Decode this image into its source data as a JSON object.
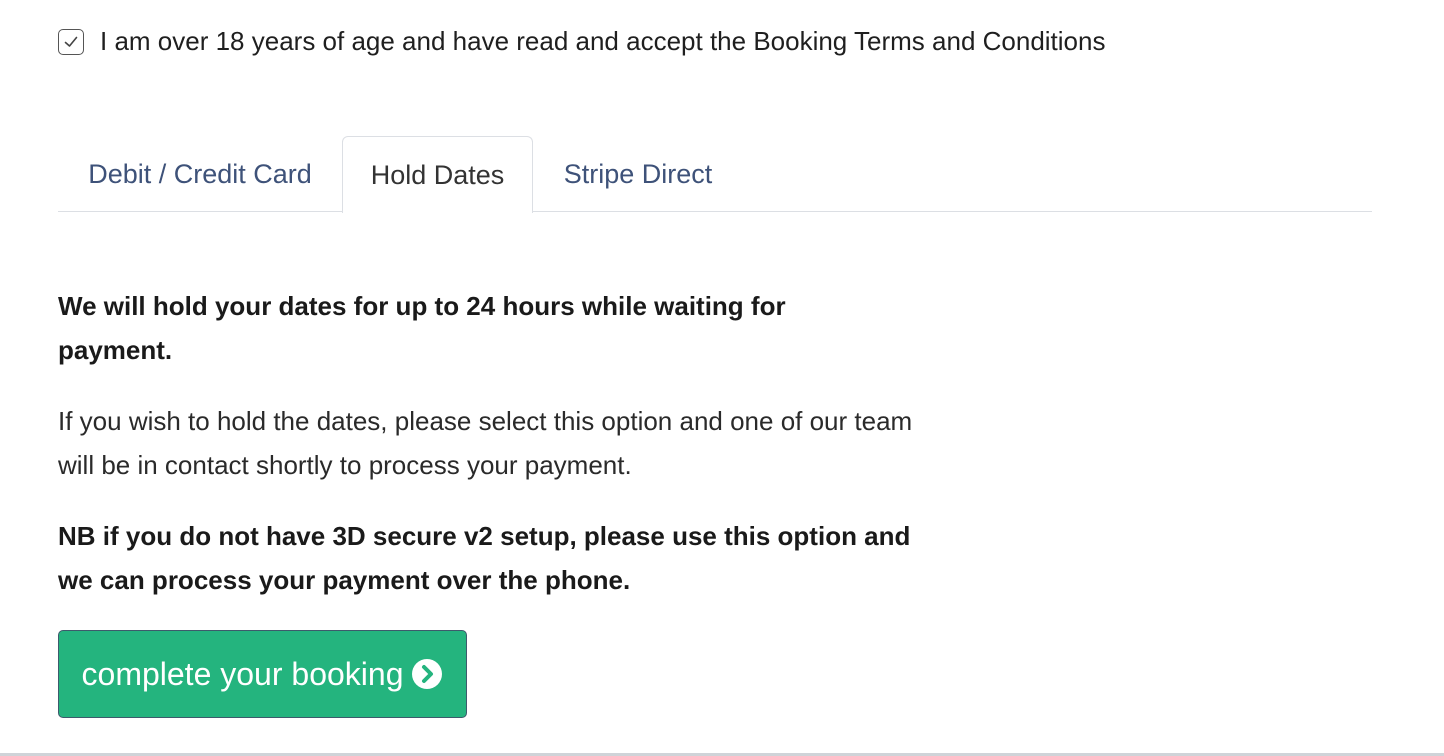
{
  "terms": {
    "checked": true,
    "label": "I am over 18 years of age and have read and accept the Booking Terms and Conditions",
    "icon": "checkmark-icon"
  },
  "tabs": [
    {
      "label": "Debit / Credit Card",
      "active": false
    },
    {
      "label": "Hold Dates",
      "active": true
    },
    {
      "label": "Stripe Direct",
      "active": false
    }
  ],
  "panel": {
    "heading": "We will hold your dates for up to 24 hours while waiting for payment.",
    "description": "If you wish to hold the dates, please select this option and one of our team will be in contact shortly to process your payment.",
    "note": "NB if you do not have 3D secure v2 setup, please use this option and we can process your payment over the phone."
  },
  "cta": {
    "label": "complete your booking",
    "icon": "chevron-circle-right-icon",
    "color": "#24b47e"
  },
  "colors": {
    "tab_text": "#3e5279",
    "active_tab_text": "#333333",
    "border": "#dcdfe4"
  }
}
